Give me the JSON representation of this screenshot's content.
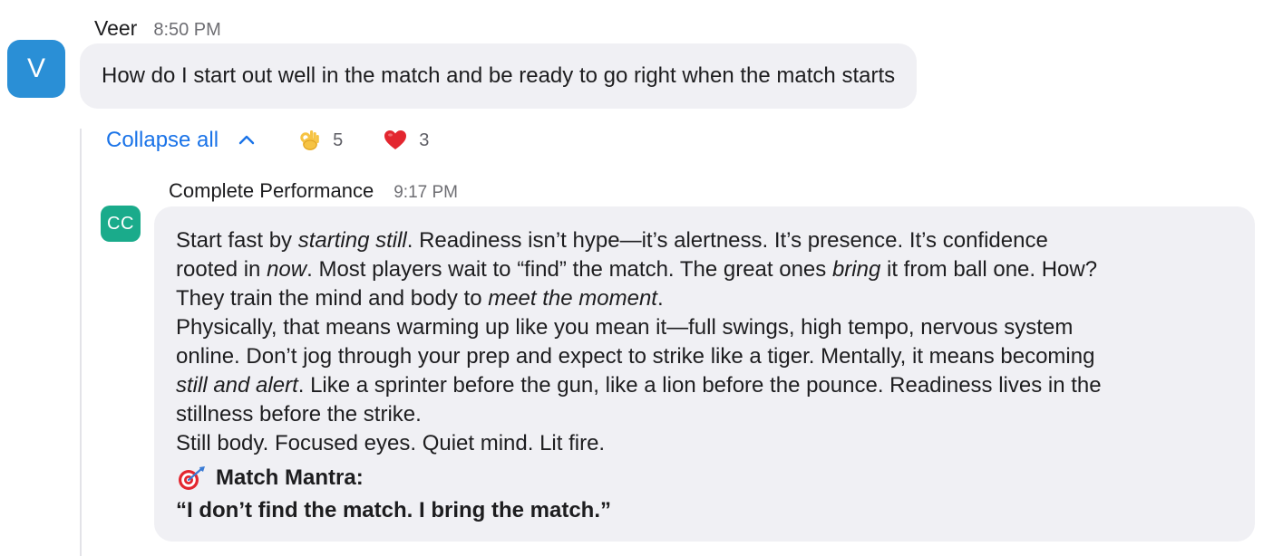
{
  "question": {
    "sender": "Veer",
    "time": "8:50 PM",
    "avatar_initial": "V",
    "text": "How do I start out well in the match and be ready to go right when the match starts"
  },
  "thread": {
    "collapse_label": "Collapse all",
    "reactions": [
      {
        "icon": "ok-hand-emoji",
        "count": "5"
      },
      {
        "icon": "red-heart-emoji",
        "count": "3"
      }
    ]
  },
  "reply": {
    "sender": "Complete Performance",
    "time": "9:17 PM",
    "avatar_initials": "CC",
    "line1": {
      "a": "Start fast by ",
      "b": "starting still",
      "c": ". Readiness isn’t hype—it’s alertness. It’s presence. It’s confidence"
    },
    "line2": {
      "a": "rooted in ",
      "b": "now",
      "c": ". Most players wait to “find” the match. The great ones ",
      "d": "bring",
      "e": " it from ball one. How?"
    },
    "line3": {
      "a": "They train the mind and body to ",
      "b": "meet the moment",
      "c": "."
    },
    "line4": "Physically, that means warming up like you mean it—full swings, high tempo, nervous system",
    "line5": "online. Don’t jog through your prep and expect to strike like a tiger. Mentally, it means becoming",
    "line6": {
      "a": "still and alert",
      "b": ". Like a sprinter before the gun, like a lion before the pounce. Readiness lives in the"
    },
    "line7": "stillness before the strike.",
    "line8": "Still body. Focused eyes. Quiet mind. Lit fire.",
    "mantra_title": "Match Mantra:",
    "mantra_quote": "“I don’t find the match. I bring the match.”"
  },
  "colors": {
    "accent_blue": "#1a73e8",
    "avatar_v": "#2a8fd6",
    "avatar_cc": "#1aab8b",
    "bubble": "#f0f0f4"
  }
}
